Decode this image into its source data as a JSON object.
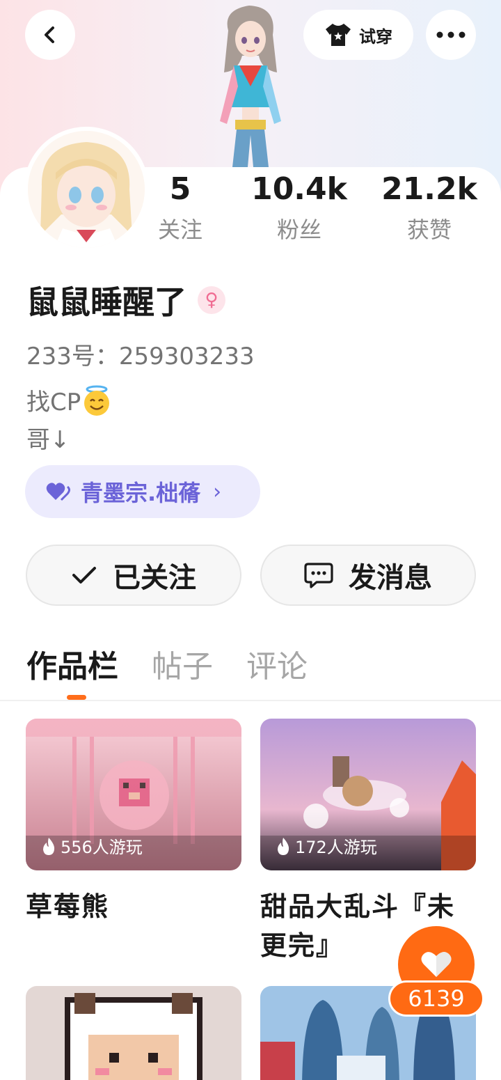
{
  "header": {
    "tryon_label": "试穿"
  },
  "stats": [
    {
      "value": "5",
      "label": "关注"
    },
    {
      "value": "10.4k",
      "label": "粉丝"
    },
    {
      "value": "21.2k",
      "label": "获赞"
    }
  ],
  "profile": {
    "username": "鼠鼠睡醒了",
    "gender_symbol": "♀",
    "uid": "233号：259303233",
    "bio_line1": "找CP",
    "bio_line2": "哥↓"
  },
  "sect": {
    "label": "青墨宗.柮蓨"
  },
  "actions": {
    "follow_label": "已关注",
    "message_label": "发消息"
  },
  "tabs": [
    "作品栏",
    "帖子",
    "评论"
  ],
  "works": [
    {
      "title": "草莓熊",
      "plays": "556人游玩"
    },
    {
      "title": "甜品大乱斗『未更完』",
      "plays": "172人游玩"
    }
  ],
  "like_count": "6139",
  "colors": {
    "accent": "#ff6a13",
    "sect_purple": "#6b63d8"
  }
}
